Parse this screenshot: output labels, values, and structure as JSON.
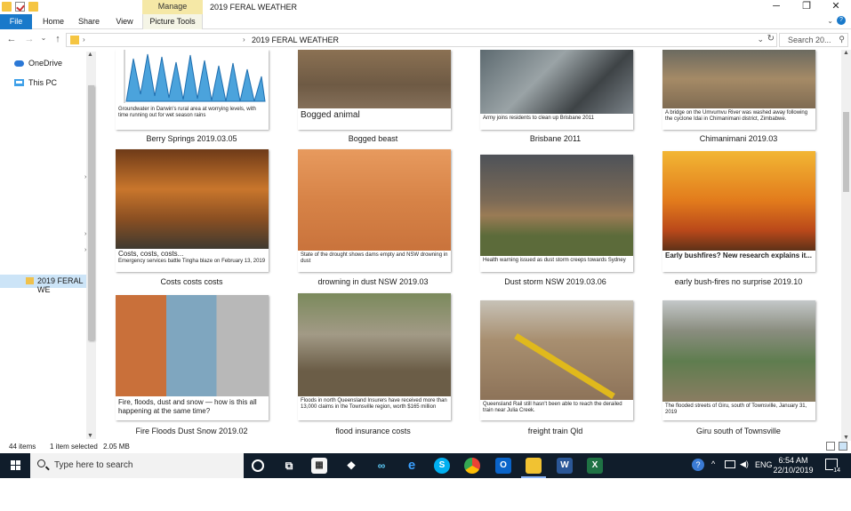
{
  "window": {
    "title": "2019 FERAL WEATHER",
    "context_tab": "Manage",
    "minimize_glyph": "─",
    "restore_glyph": "❐",
    "close_glyph": "✕"
  },
  "ribbon": {
    "tabs": [
      "File",
      "Home",
      "Share",
      "View",
      "Picture Tools"
    ],
    "collapse_glyph": "⌄",
    "help_glyph": "?"
  },
  "address": {
    "back_glyph": "←",
    "forward_glyph": "→",
    "recent_glyph": "⌄",
    "up_glyph": "↑",
    "sep1": "›",
    "sep2": "›",
    "path": "2019 FERAL WEATHER",
    "dropdown_glyph": "⌄",
    "refresh_glyph": "↻",
    "search_placeholder": "Search 20...",
    "search_glyph": "⚲"
  },
  "nav": {
    "onedrive": "OneDrive",
    "thispc": "This PC",
    "selected_folder": "2019 FERAL WE",
    "tick_glyph": "›"
  },
  "files": [
    {
      "label": "Berry Springs 2019.03.05",
      "caption": "Groundwater in Darwin's rural area at worrying levels, with time running out for wet season rains",
      "caption_big": false
    },
    {
      "label": "Bogged beast",
      "caption": "Bogged animal",
      "caption_big": true
    },
    {
      "label": "Brisbane 2011",
      "caption": "Army joins residents to clean up Brisbane 2011",
      "caption_big": false
    },
    {
      "label": "Chimanimani 2019.03",
      "caption": "A bridge on the Umvumvu River was washed away following the cyclone Idai in Chimanimani district, Zimbabwe.",
      "caption_big": false
    },
    {
      "label": "Costs costs costs",
      "caption": "Costs, costs, costs...",
      "caption2": "Emergency services battle Tingha blaze on February 13, 2019",
      "caption_big": false
    },
    {
      "label": "drowning in dust NSW 2019.03",
      "caption": "State of the drought shows dams empty and NSW drowning in dust",
      "caption_big": false
    },
    {
      "label": "Dust storm NSW 2019.03.06",
      "caption": "Health warning issued as dust storm creeps towards Sydney",
      "caption_big": false
    },
    {
      "label": "early bush-fires no surprise 2019.10",
      "caption": "Early bushfires? New research explains it...",
      "caption_big": false
    },
    {
      "label": "Fire Floods Dust Snow 2019.02",
      "caption": "Fire, floods, dust and snow — how is this all happening at the same time?",
      "caption_big": false
    },
    {
      "label": "flood insurance costs",
      "caption": "Floods in north Queensland    Insurers have received more than 13,000 claims in the Townsville region, worth $165 million",
      "caption_big": false
    },
    {
      "label": "freight train Qld",
      "caption": "Queensland Rail still hasn't been able to reach the derailed train near Julia Creek.",
      "caption_big": false
    },
    {
      "label": "Giru south of Townsville",
      "caption": "The flooded streets of Giru, south of Townsville, January 31, 2019",
      "caption_big": false
    }
  ],
  "status": {
    "count": "44 items",
    "selected": "1 item selected",
    "size": "2.05 MB"
  },
  "taskbar": {
    "search_placeholder": "Type here to search",
    "time": "6:54 AM",
    "date": "22/10/2019",
    "lang": "ENG",
    "notifications": "14",
    "pinned": [
      "cortana-icon",
      "task-view-icon",
      "store-icon",
      "dropbox-icon",
      "infinity-icon",
      "edge-icon",
      "skype-icon",
      "chrome-icon",
      "outlook-icon",
      "explorer-icon",
      "word-icon",
      "excel-icon"
    ],
    "edge_glyph": "e",
    "skype_glyph": "S",
    "outlook_glyph": "O",
    "word_glyph": "W",
    "excel_glyph": "X",
    "chevron_glyph": "^",
    "volume_glyph": "◀)"
  }
}
